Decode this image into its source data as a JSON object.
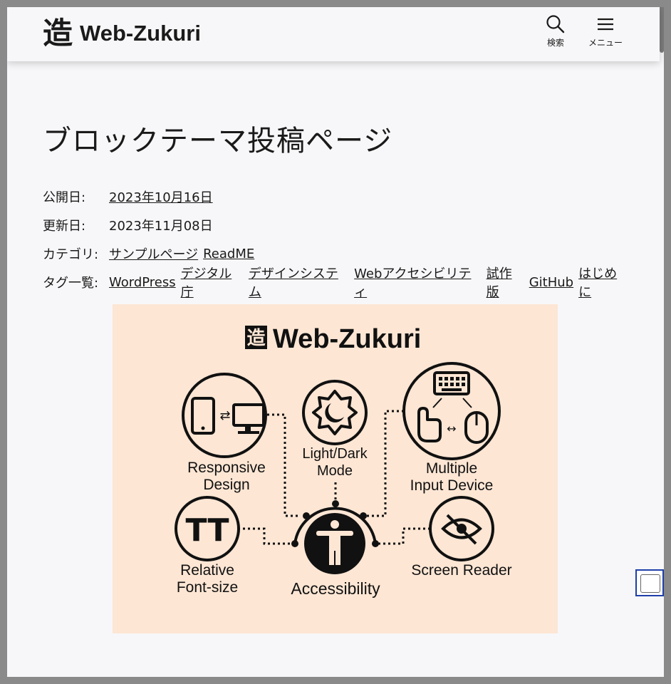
{
  "site": {
    "logo_glyph": "造",
    "name": "Web-Zukuri"
  },
  "header": {
    "search_label": "検索",
    "menu_label": "メニュー"
  },
  "post": {
    "title": "ブロックテーマ投稿ページ",
    "published_label": "公開日:",
    "published_date": "2023年10月16日",
    "updated_label": "更新日:",
    "updated_date": "2023年11月08日",
    "category_label": "カテゴリ:",
    "categories": [
      "サンプルページ",
      "ReadME"
    ],
    "tags_label": "タグ一覧:",
    "tags": [
      "WordPress",
      "デジタル庁",
      "デザインシステム",
      "Webアクセシビリティ",
      "試作版",
      "GitHub",
      "はじめに"
    ]
  },
  "featured_image": {
    "brand_glyph": "造",
    "brand": "Web-Zukuri",
    "center_label": "Accessibility",
    "features": {
      "responsive": [
        "Responsive",
        "Design"
      ],
      "lightdark": [
        "Light/Dark",
        "Mode"
      ],
      "multiple": [
        "Multiple",
        "Input Device"
      ],
      "fontsize": [
        "Relative",
        "Font-size"
      ],
      "screenreader": [
        "Screen Reader"
      ],
      "fontsize_icon": "TT"
    },
    "background": "#fde6d4"
  }
}
